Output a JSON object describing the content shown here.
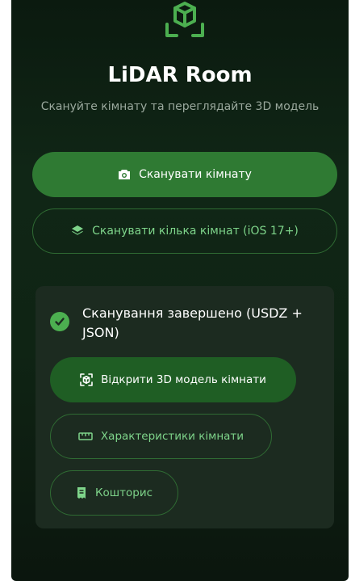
{
  "app": {
    "title": "LiDAR Room",
    "subtitle": "Скануйте кімнату та переглядайте 3D модель"
  },
  "actions": {
    "scan_room": "Сканувати кімнату",
    "scan_multi": "Сканувати кілька кімнат (iOS 17+)"
  },
  "result": {
    "status": "Сканування завершено (USDZ + JSON)",
    "open_model": "Відкрити 3D модель кімнати",
    "characteristics": "Характеристики кімнати",
    "estimate": "Кошторис"
  },
  "icons": {
    "logo": "cube-scan-icon",
    "scan_room": "camera-icon",
    "scan_multi": "layers-icon",
    "status": "check-circle-icon",
    "open_model": "view-3d-icon",
    "characteristics": "ruler-icon",
    "estimate": "receipt-icon"
  },
  "colors": {
    "background": "#102616",
    "primary": "#2f7a33",
    "accent": "#7ed48a",
    "success": "#4caf50"
  }
}
